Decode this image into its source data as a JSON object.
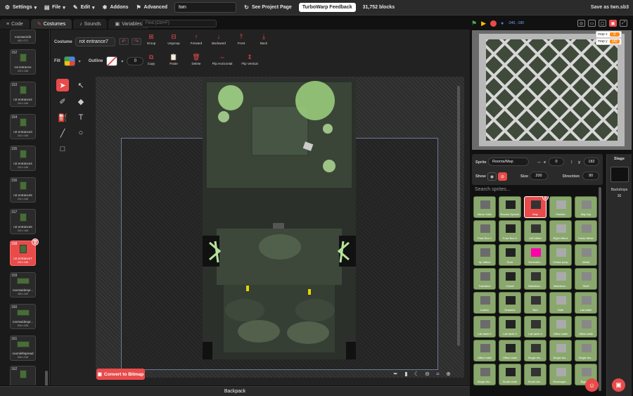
{
  "menubar": {
    "settings": "Settings",
    "file": "File",
    "edit": "Edit",
    "addons": "Addons",
    "advanced": "Advanced",
    "project_title": "twn",
    "see_project_page": "See Project Page",
    "feedback": "TurboWarp Feedback",
    "block_count": "31,752 blocks",
    "save_as": "Save as twn.sb3"
  },
  "tabs": {
    "code": "Code",
    "costumes": "Costumes",
    "sounds": "Sounds",
    "variables": "Variables"
  },
  "find_placeholder": "Find (Ctrl+F)",
  "costumes": [
    {
      "num": "",
      "name": "roomweird3",
      "size": "482 x 371"
    },
    {
      "num": "152",
      "name": "rot entrance",
      "size": "242 x 446"
    },
    {
      "num": "153",
      "name": "rot entrance2",
      "size": "242 x 446"
    },
    {
      "num": "154",
      "name": "rot entrance3",
      "size": "242 x 446"
    },
    {
      "num": "155",
      "name": "rot entrance4",
      "size": "242 x 446"
    },
    {
      "num": "156",
      "name": "rot entrance5",
      "size": "242 x 446"
    },
    {
      "num": "157",
      "name": "rot entrance6",
      "size": "242 x 446"
    },
    {
      "num": "158",
      "name": "rot entrance7",
      "size": "242 x 446"
    },
    {
      "num": "159",
      "name": "roomwidespr...",
      "size": "495 x 309"
    },
    {
      "num": "160",
      "name": "roomwidespr...",
      "size": "506 x 308"
    },
    {
      "num": "161",
      "name": "roomleftspread",
      "size": "506 x 316"
    },
    {
      "num": "162",
      "name": "",
      "size": ""
    }
  ],
  "editor": {
    "costume_label": "Costume",
    "costume_name": "rot entrance7",
    "fill_label": "Fill",
    "outline_label": "Outline",
    "outline_width": "0",
    "actions": [
      "Group",
      "Ungroup",
      "Forward",
      "Backward",
      "Front",
      "Back"
    ],
    "actions2": [
      "Copy",
      "Paste",
      "Delete",
      "Flip Horizontal",
      "Flip Vertical"
    ],
    "convert": "Convert to Bitmap",
    "zoom_eq": "="
  },
  "backpack": "Backpack",
  "stage": {
    "coords": "-240, -180",
    "monitors": [
      {
        "label": "map x",
        "value": "0"
      },
      {
        "label": "map y",
        "value": "182"
      }
    ]
  },
  "sprite_info": {
    "sprite_label": "Sprite",
    "sprite_name": "Rooms/Map",
    "x": "0",
    "y": "182",
    "y_label": "y",
    "show_label": "Show",
    "size_label": "Size",
    "size": "200",
    "direction_label": "Direction",
    "direction": "90"
  },
  "sprite_search": "Search sprites...",
  "sprites": [
    "Menu Yoke",
    "Rooms Opener",
    "Map",
    "Particle",
    "Map top",
    "Fuse Box 1",
    "Fuse Box 2",
    "Left hitbox",
    "Right hitbox",
    "Down hitbox",
    "Up hitbox",
    "Door",
    "Generato...",
    "Chase jump",
    "Metal",
    "Transition",
    "Closet",
    "Maintena...",
    "Maintena...",
    "Shelf",
    "Locker",
    "Drawers",
    "Bed",
    "Safe",
    "Lab table",
    "Lab table 2",
    "Lab table 3",
    "Lab table 4",
    "Office table",
    "Office table",
    "Office table",
    "Office table",
    "Single tes...",
    "Single tes...",
    "Single tes...",
    "Single tes...",
    "Small circle",
    "Small circ...",
    "Rectangle...",
    "Bigger..."
  ],
  "stage_panel": {
    "title": "Stage",
    "backdrops_label": "Backdrops",
    "backdrops_count": "30"
  },
  "colors": {
    "accent": "#e94b4b",
    "sprite_tile": "#8aa86e",
    "bg": "#222222"
  }
}
